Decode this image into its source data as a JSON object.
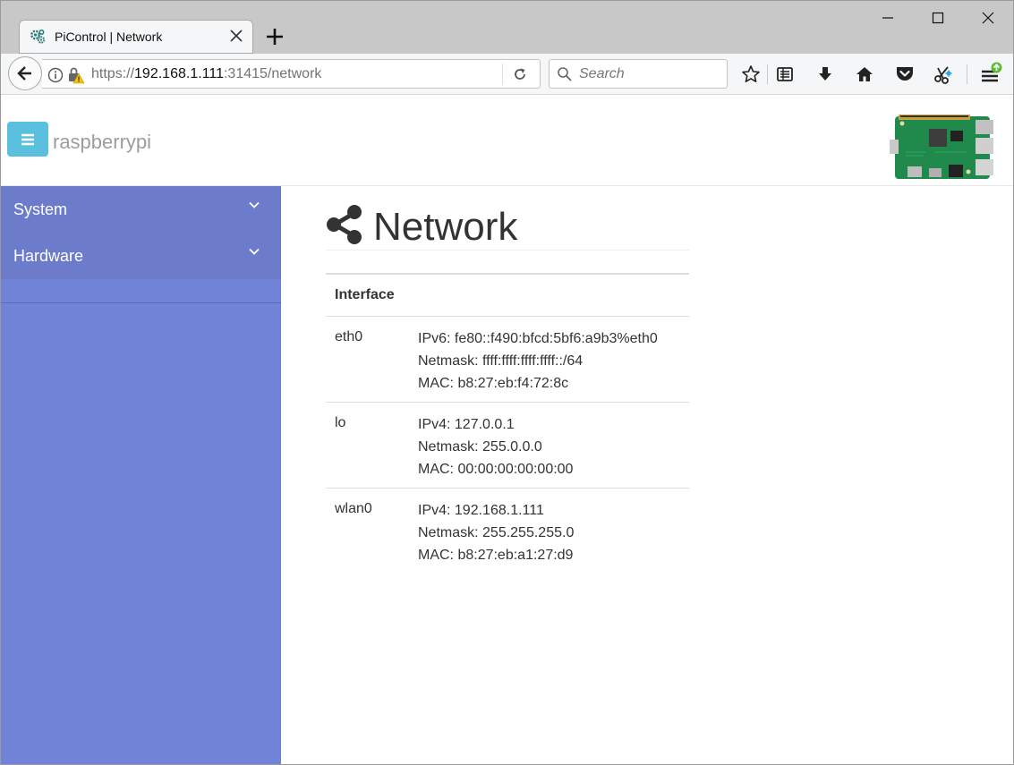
{
  "browser": {
    "tab": {
      "title": "PiControl | Network"
    },
    "url": {
      "scheme": "https://",
      "host": "192.168.1.111",
      "port_path": ":31415/network"
    },
    "search": {
      "placeholder": "Search"
    }
  },
  "header": {
    "brand": "raspberrypi"
  },
  "sidebar": {
    "items": [
      {
        "label": "System"
      },
      {
        "label": "Hardware"
      }
    ]
  },
  "main": {
    "title": "Network",
    "table": {
      "header": "Interface",
      "rows": [
        {
          "interface": "eth0",
          "address": "IPv6: fe80::f490:bfcd:5bf6:a9b3%eth0",
          "netmask": "Netmask: ffff:ffff:ffff:ffff::/64",
          "mac": "MAC: b8:27:eb:f4:72:8c"
        },
        {
          "interface": "lo",
          "address": "IPv4: 127.0.0.1",
          "netmask": "Netmask: 255.0.0.0",
          "mac": "MAC: 00:00:00:00:00:00"
        },
        {
          "interface": "wlan0",
          "address": "IPv4: 192.168.1.111",
          "netmask": "Netmask: 255.255.255.0",
          "mac": "MAC: b8:27:eb:a1:27:d9"
        }
      ]
    }
  },
  "colors": {
    "sidebar": "#7083d6",
    "sidebar_menu": "#6c7ccb",
    "toggle_button": "#5bc0de"
  }
}
